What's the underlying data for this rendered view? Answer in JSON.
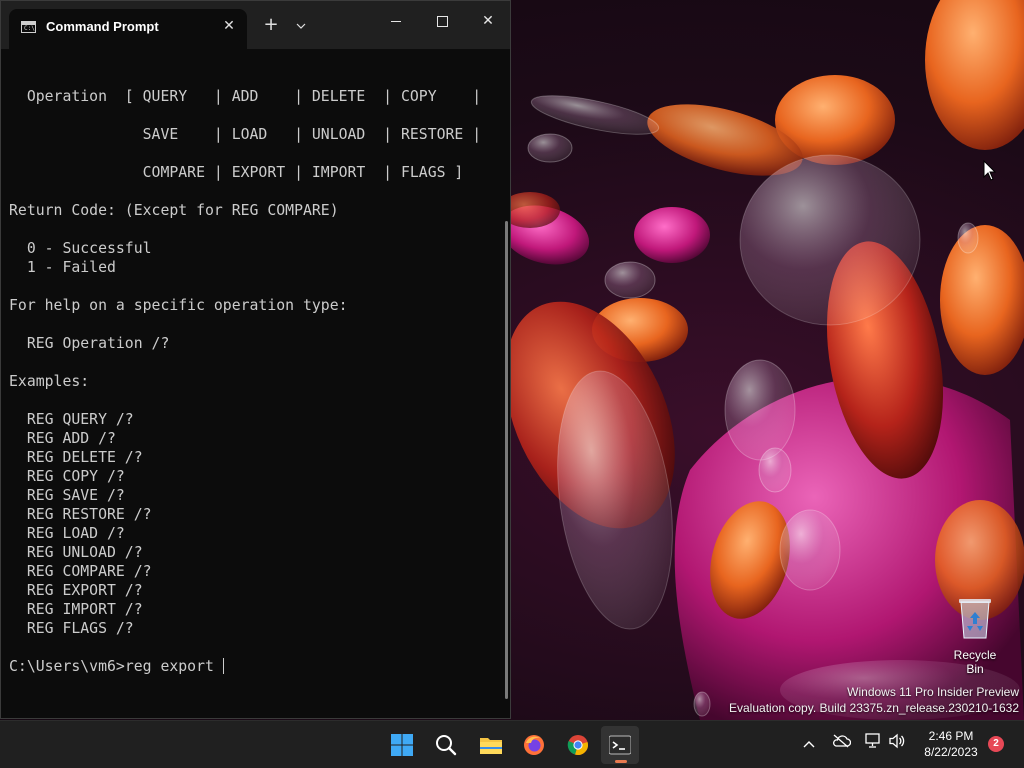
{
  "window": {
    "tab_title": "Command Prompt",
    "new_tab_glyph": "+",
    "tab_close_glyph": "✕",
    "dropdown_glyph": "⌄",
    "close_glyph": "✕"
  },
  "terminal": {
    "lines": [
      "",
      "  Operation  [ QUERY   | ADD    | DELETE  | COPY    |",
      "",
      "               SAVE    | LOAD   | UNLOAD  | RESTORE |",
      "",
      "               COMPARE | EXPORT | IMPORT  | FLAGS ]",
      "",
      "Return Code: (Except for REG COMPARE)",
      "",
      "  0 - Successful",
      "  1 - Failed",
      "",
      "For help on a specific operation type:",
      "",
      "  REG Operation /?",
      "",
      "Examples:",
      "",
      "  REG QUERY /?",
      "  REG ADD /?",
      "  REG DELETE /?",
      "  REG COPY /?",
      "  REG SAVE /?",
      "  REG RESTORE /?",
      "  REG LOAD /?",
      "  REG UNLOAD /?",
      "  REG COMPARE /?",
      "  REG EXPORT /?",
      "  REG IMPORT /?",
      "  REG FLAGS /?",
      ""
    ],
    "prompt": "C:\\Users\\vm6>",
    "command": "reg export "
  },
  "desktop": {
    "recycle_bin_label": "Recycle Bin",
    "watermark_line1": "Windows 11 Pro Insider Preview",
    "watermark_line2": "Evaluation copy. Build 23375.zn_release.230210-1632"
  },
  "taskbar": {
    "apps": [
      "start-icon",
      "search-icon",
      "file-explorer-icon",
      "firefox-icon",
      "chrome-icon",
      "terminal-icon"
    ],
    "time": "2:46 PM",
    "date": "8/22/2023",
    "notification_count": "2",
    "tray_chevron_glyph": "^"
  },
  "colors": {
    "terminal_bg": "#0c0c0c",
    "terminal_fg": "#cccccc",
    "titlebar_bg": "#202020",
    "taskbar_bg": "#202020",
    "badge": "#e74856"
  }
}
